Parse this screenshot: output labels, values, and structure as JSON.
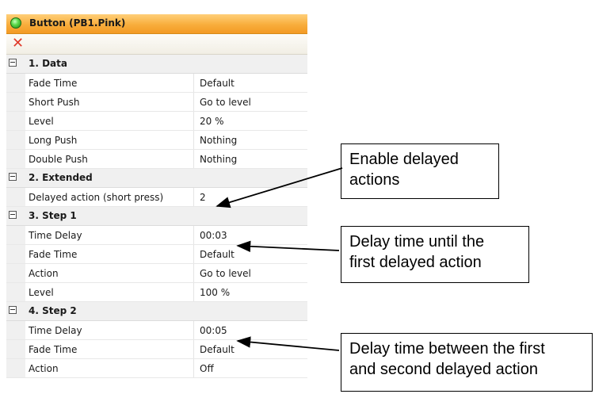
{
  "window": {
    "title": "Button (PB1.Pink)"
  },
  "toolbar": {
    "delete_icon": "close-icon",
    "delete_color": "#e03a2a"
  },
  "properties": {
    "cat1": {
      "label": "1. Data",
      "rows": [
        {
          "name": "Fade Time",
          "value": "Default"
        },
        {
          "name": "Short Push",
          "value": "Go to level"
        },
        {
          "name": "Level",
          "value": "20 %"
        },
        {
          "name": "Long Push",
          "value": "Nothing"
        },
        {
          "name": "Double Push",
          "value": "Nothing"
        }
      ]
    },
    "cat2": {
      "label": "2. Extended",
      "rows": [
        {
          "name": "Delayed action (short press)",
          "value": "2"
        }
      ]
    },
    "cat3": {
      "label": "3. Step 1",
      "rows": [
        {
          "name": "Time Delay",
          "value": "00:03"
        },
        {
          "name": "Fade Time",
          "value": "Default"
        },
        {
          "name": "Action",
          "value": "Go to level"
        },
        {
          "name": "Level",
          "value": "100 %"
        }
      ]
    },
    "cat4": {
      "label": "4. Step 2",
      "rows": [
        {
          "name": "Time Delay",
          "value": "00:05"
        },
        {
          "name": "Fade Time",
          "value": "Default"
        },
        {
          "name": "Action",
          "value": "Off"
        }
      ]
    }
  },
  "callouts": {
    "c1": {
      "line1": "Enable delayed",
      "line2": "actions"
    },
    "c2": {
      "line1": "Delay time until the",
      "line2": "first delayed action"
    },
    "c3": {
      "line1": "Delay time between the first",
      "line2": "and second delayed action"
    }
  }
}
